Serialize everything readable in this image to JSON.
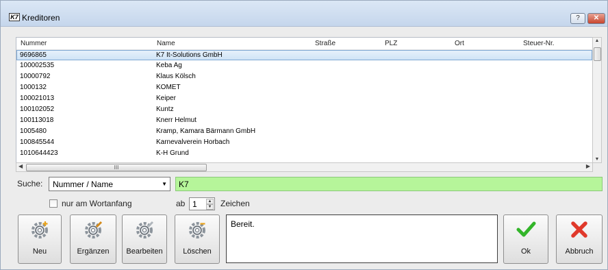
{
  "window": {
    "title": "Kreditoren",
    "app_icon_text": "K7",
    "help_label": "?",
    "close_label": "✕"
  },
  "grid": {
    "columns": [
      "Nummer",
      "Name",
      "Straße",
      "PLZ",
      "Ort",
      "Steuer-Nr."
    ],
    "rows": [
      {
        "nummer": "9696865",
        "name": "K7 It-Solutions GmbH"
      },
      {
        "nummer": "100002535",
        "name": "Keba Ag"
      },
      {
        "nummer": "10000792",
        "name": "Klaus Kölsch"
      },
      {
        "nummer": "1000132",
        "name": "KOMET"
      },
      {
        "nummer": "100021013",
        "name": "Keiper"
      },
      {
        "nummer": "100102052",
        "name": "Kuntz"
      },
      {
        "nummer": "100113018",
        "name": "Knerr Helmut"
      },
      {
        "nummer": "1005480",
        "name": "Kramp, Kamara Bärmann GmbH"
      },
      {
        "nummer": "100845544",
        "name": "Karnevalverein Horbach"
      },
      {
        "nummer": "1010644423",
        "name": "K-H Grund"
      }
    ],
    "hscroll_thumb_label": "III"
  },
  "search": {
    "label": "Suche:",
    "field_option": "Nummer / Name",
    "value": "K7",
    "prefix_only_label": "nur am Wortanfang",
    "from_label": "ab",
    "min_chars": "1",
    "chars_label": "Zeichen"
  },
  "buttons": {
    "new": "Neu",
    "extend": "Ergänzen",
    "edit": "Bearbeiten",
    "delete": "Löschen",
    "ok": "Ok",
    "cancel": "Abbruch"
  },
  "status_text": "Bereit.",
  "colors": {
    "search_bg": "#b6f59a",
    "selected_row": "#cfe3f6",
    "ok_green": "#33b52a",
    "cancel_red": "#e0392b"
  }
}
